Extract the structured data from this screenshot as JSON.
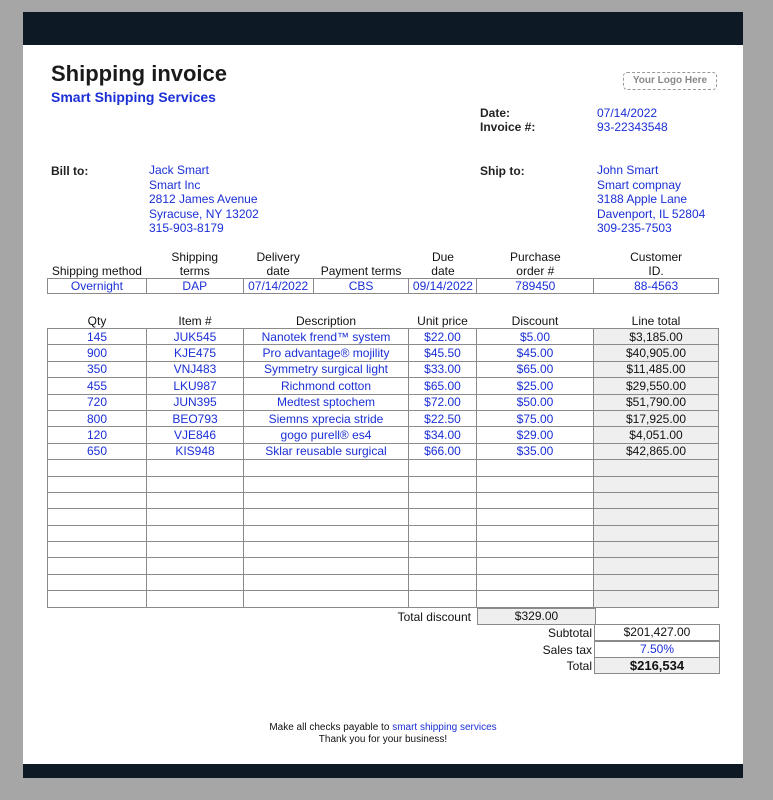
{
  "header": {
    "title": "Shipping invoice",
    "company": "Smart Shipping Services",
    "logo_text": "Your Logo Here"
  },
  "meta": {
    "date_label": "Date:",
    "date": "07/14/2022",
    "invoice_label": "Invoice #:",
    "invoice_no": "93-22343548"
  },
  "bill_to": {
    "label": "Bill to:",
    "lines": [
      "Jack Smart",
      "Smart Inc",
      "2812 James Avenue",
      "Syracuse, NY 13202",
      "315-903-8179"
    ]
  },
  "ship_to": {
    "label": "Ship to:",
    "lines": [
      "John Smart",
      "Smart compnay",
      "3188 Apple Lane",
      "Davenport, IL 52804",
      "309-235-7503"
    ]
  },
  "shipping": {
    "headers": [
      "Shipping method",
      "Shipping",
      "Delivery",
      "Payment terms",
      "Due",
      "Purchase",
      "Customer"
    ],
    "headers_2": [
      "",
      "terms",
      "date",
      "",
      "date",
      "order #",
      "ID."
    ],
    "values": [
      "Overnight",
      "DAP",
      "07/14/2022",
      "CBS",
      "09/14/2022",
      "789450",
      "88-4563"
    ]
  },
  "items": {
    "headers": [
      "Qty",
      "Item #",
      "Description",
      "Unit price",
      "Discount",
      "Line total"
    ],
    "rows": [
      [
        "145",
        "JUK545",
        "Nanotek frend™ system",
        "$22.00",
        "$5.00",
        "$3,185.00"
      ],
      [
        "900",
        "KJE475",
        "Pro advantage® mojility",
        "$45.50",
        "$45.00",
        "$40,905.00"
      ],
      [
        "350",
        "VNJ483",
        "Symmetry surgical light",
        "$33.00",
        "$65.00",
        "$11,485.00"
      ],
      [
        "455",
        "LKU987",
        "Richmond cotton",
        "$65.00",
        "$25.00",
        "$29,550.00"
      ],
      [
        "720",
        "JUN395",
        "Medtest sptochem",
        "$72.00",
        "$50.00",
        "$51,790.00"
      ],
      [
        "800",
        "BEO793",
        "Siemns xprecia stride",
        "$22.50",
        "$75.00",
        "$17,925.00"
      ],
      [
        "120",
        "VJE846",
        "gogo purell® es4",
        "$34.00",
        "$29.00",
        "$4,051.00"
      ],
      [
        "650",
        "KIS948",
        "Sklar reusable surgical",
        "$66.00",
        "$35.00",
        "$42,865.00"
      ],
      [
        "",
        "",
        "",
        "",
        "",
        ""
      ],
      [
        "",
        "",
        "",
        "",
        "",
        ""
      ],
      [
        "",
        "",
        "",
        "",
        "",
        ""
      ],
      [
        "",
        "",
        "",
        "",
        "",
        ""
      ],
      [
        "",
        "",
        "",
        "",
        "",
        ""
      ],
      [
        "",
        "",
        "",
        "",
        "",
        ""
      ],
      [
        "",
        "",
        "",
        "",
        "",
        ""
      ],
      [
        "",
        "",
        "",
        "",
        "",
        ""
      ],
      [
        "",
        "",
        "",
        "",
        "",
        ""
      ]
    ]
  },
  "totals": {
    "total_discount_label": "Total discount",
    "total_discount": "$329.00",
    "subtotal_label": "Subtotal",
    "subtotal": "$201,427.00",
    "sales_tax_label": "Sales tax",
    "sales_tax": "7.50%",
    "total_label": "Total",
    "total": "$216,534"
  },
  "footer": {
    "payable_prefix": "Make all checks payable to",
    "payee": "smart shipping services",
    "thanks": "Thank you for your business!"
  }
}
